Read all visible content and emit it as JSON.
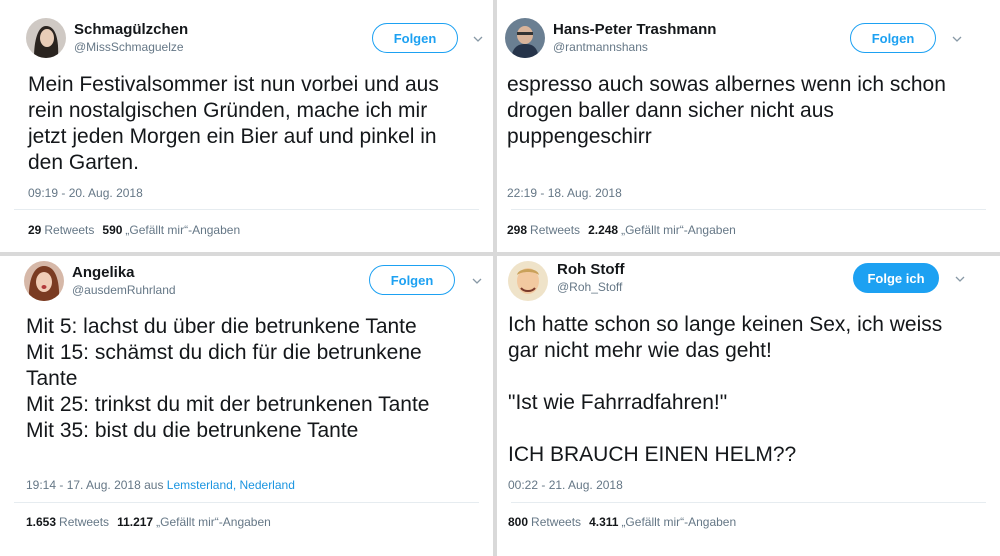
{
  "tweets": [
    {
      "name": "Schmagülzchen",
      "handle": "@MissSchmaguelze",
      "follow_label": "Folgen",
      "text": "Mein Festivalsommer ist nun vorbei und aus\nrein nostalgischen Gründen, mache ich mir\njetzt jeden Morgen ein Bier auf und pinkel in\nden Garten.",
      "timestamp": "09:19 - 20. Aug. 2018",
      "retweets_count": "29",
      "retweets_label": "Retweets",
      "likes_count": "590",
      "likes_label": "„Gefällt mir“-Angaben"
    },
    {
      "name": "Hans-Peter Trashmann",
      "handle": "@rantmannshans",
      "follow_label": "Folgen",
      "text": "espresso auch sowas albernes wenn ich schon\ndrogen baller dann sicher nicht aus\npuppengeschirr",
      "timestamp": "22:19 - 18. Aug. 2018",
      "retweets_count": "298",
      "retweets_label": "Retweets",
      "likes_count": "2.248",
      "likes_label": "„Gefällt mir“-Angaben"
    },
    {
      "name": "Angelika",
      "handle": "@ausdemRuhrland",
      "follow_label": "Folgen",
      "text": "Mit 5: lachst du über die betrunkene Tante\nMit 15: schämst du dich für die betrunkene\nTante\nMit 25: trinkst du mit der betrunkenen Tante\nMit 35: bist du die betrunkene Tante",
      "timestamp": "19:14 - 17. Aug. 2018 aus",
      "location": "Lemsterland, Nederland",
      "retweets_count": "1.653",
      "retweets_label": "Retweets",
      "likes_count": "11.217",
      "likes_label": "„Gefällt mir“-Angaben"
    },
    {
      "name": "Roh Stoff",
      "handle": "@Roh_Stoff",
      "follow_label": "Folge ich",
      "text": "Ich hatte schon so lange keinen Sex, ich weiss\ngar nicht mehr wie das geht!\n\n\"Ist wie Fahrradfahren!\"\n\nICH BRAUCH EINEN HELM??",
      "timestamp": "00:22 - 21. Aug. 2018",
      "retweets_count": "800",
      "retweets_label": "Retweets",
      "likes_count": "4.311",
      "likes_label": "„Gefällt mir“-Angaben"
    }
  ],
  "colors": {
    "accent": "#1da1f2",
    "muted": "#657786",
    "link": "#1b95e0",
    "separator": "#d9d9d9"
  },
  "icons": {
    "menu": "chevron-down-icon"
  }
}
